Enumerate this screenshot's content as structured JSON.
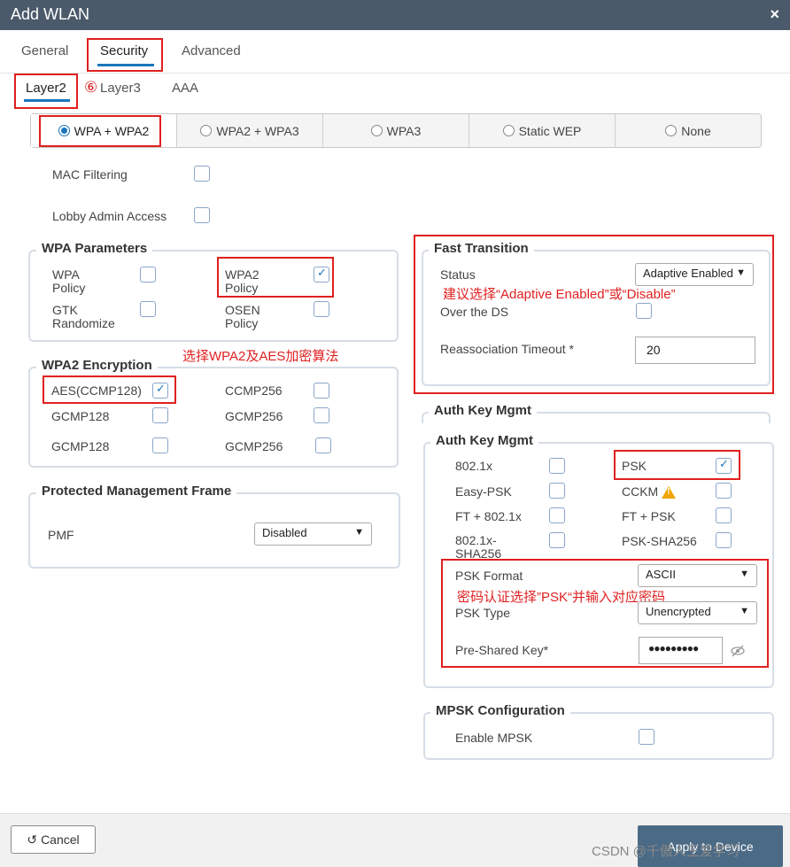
{
  "window": {
    "title": "Add WLAN",
    "close": "×"
  },
  "tabs": {
    "general": "General",
    "security": "Security",
    "advanced": "Advanced"
  },
  "subtabs": {
    "layer2": "Layer2",
    "step": "⑥",
    "layer3": "Layer3",
    "aaa": "AAA"
  },
  "security_modes": [
    "WPA + WPA2",
    "WPA2 + WPA3",
    "WPA3",
    "Static WEP",
    "None"
  ],
  "mac_filtering": "MAC Filtering",
  "lobby_admin": "Lobby Admin Access",
  "wpa_params": {
    "title": "WPA Parameters",
    "wpa_policy_1": "WPA",
    "wpa_policy_2": "Policy",
    "wpa2_policy_1": "WPA2",
    "wpa2_policy_2": "Policy",
    "gtk_1": "GTK",
    "gtk_2": "Randomize",
    "osen_1": "OSEN",
    "osen_2": "Policy"
  },
  "note_wpa2": "选择WPA2及AES加密算法",
  "wpa2_enc": {
    "title": "WPA2 Encryption",
    "aes": "AES(CCMP128)",
    "ccmp256": "CCMP256",
    "gcmp128_a": "GCMP128",
    "gcmp256_a": "GCMP256",
    "gcmp128": "GCMP128",
    "gcmp256": "GCMP256"
  },
  "pmf": {
    "title": "Protected Management Frame",
    "label": "PMF",
    "value": "Disabled"
  },
  "fast_transition": {
    "title": "Fast Transition",
    "status_label": "Status",
    "status_value": "Adaptive Enabled",
    "over_ds": "Over the DS",
    "reassoc_label": "Reassociation Timeout *",
    "reassoc_value": "20"
  },
  "note_ft": "建议选择“Adaptive Enabled”或“Disable”",
  "auth_key_bg": "Auth Key Mgmt",
  "auth_key": {
    "title": "Auth Key Mgmt",
    "dot1x": "802.1x",
    "psk": "PSK",
    "easy_psk": "Easy-PSK",
    "cckm": "CCKM",
    "ft_dot1x": "FT + 802.1x",
    "ft_psk": "FT + PSK",
    "sha_1": "802.1x-",
    "sha_2": "SHA256",
    "psk_sha": "PSK-SHA256",
    "psk_format_label": "PSK Format",
    "psk_format_value": "ASCII",
    "psk_type_label": "PSK Type",
    "psk_type_value": "Unencrypted",
    "preshared_label": "Pre-Shared Key*",
    "preshared_value": "●●●●●●●●●"
  },
  "note_psk": "密码认证选择”PSK“并输入对应密码",
  "mpsk": {
    "title": "MPSK Configuration",
    "enable": "Enable MPSK"
  },
  "footer": {
    "cancel": "Cancel",
    "apply": "Apply to Device"
  },
  "watermark": "CSDN @千傲人王爱学习",
  "colors": {
    "accent": "#1b75bb",
    "annotation": "#e02020",
    "titlebar": "#4b5a6a"
  }
}
